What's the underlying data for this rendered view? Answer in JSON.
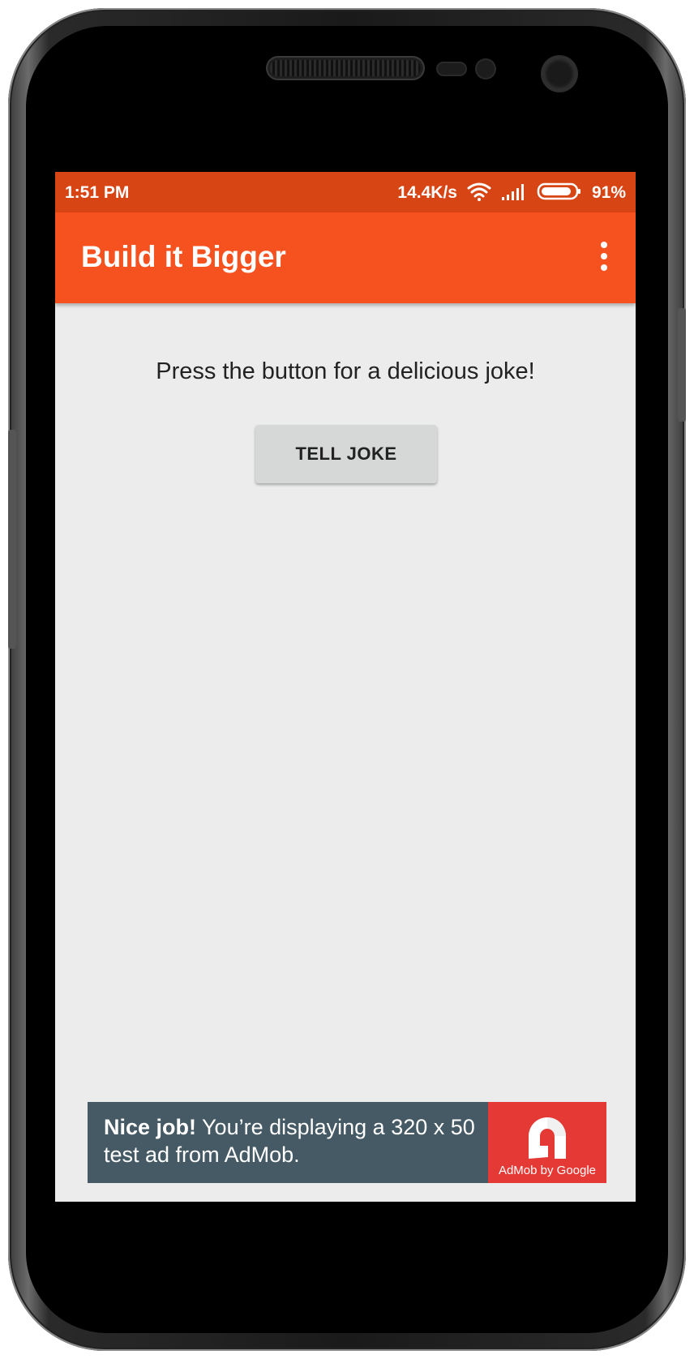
{
  "status_bar": {
    "time": "1:51 PM",
    "network_speed": "14.4K/s",
    "battery_percent": "91%",
    "battery_level": 0.91,
    "icons": [
      "wifi-icon",
      "signal-icon",
      "battery-icon"
    ]
  },
  "app_bar": {
    "title": "Build it Bigger",
    "menu_icon": "overflow-menu-icon",
    "color": "#f5521f"
  },
  "main": {
    "prompt": "Press the button for a delicious joke!",
    "button_label": "TELL JOKE"
  },
  "ad": {
    "headline": "Nice job!",
    "body": " You’re displaying a 320 x 50 test ad from AdMob.",
    "brand_label": "AdMob by Google",
    "colors": {
      "banner": "#455a64",
      "logo_bg": "#e53935"
    }
  }
}
